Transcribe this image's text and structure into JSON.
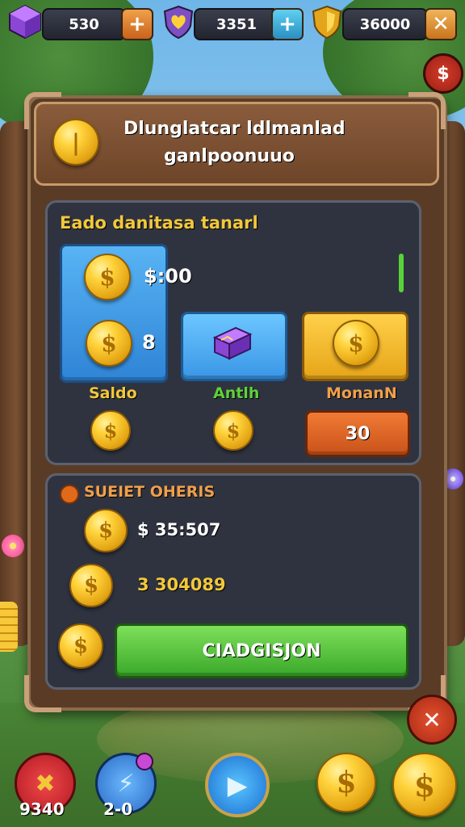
{
  "topbar": {
    "currency1": "530",
    "currency2": "3351",
    "currency3": "36000",
    "plus1": "+",
    "plus2": "+",
    "close": "✕",
    "dollar_badge": "$"
  },
  "header": {
    "title_line1": "Dlunglatcar ldlmanlad",
    "title_line2": "ganlpoonuuo"
  },
  "offers": {
    "title": "Eado danitasa tanarl",
    "slot1_amount": "$:00",
    "slot1_count": "8",
    "labels": [
      "Saldo",
      "Antlh",
      "MonanN"
    ],
    "buy_value": "30"
  },
  "history": {
    "title": "SUEIET OHERIS",
    "row1": "$ 35:507",
    "row2": "3 304089",
    "confirm": "CIADGISJON"
  },
  "bottombar": {
    "left_count": "9340",
    "mid_count": "2-0"
  },
  "colors": {
    "accent_gold": "#f2c83a",
    "green_button": "#4cbf3a",
    "orange_button": "#e0621f",
    "blue_slot": "#3a9be8"
  }
}
